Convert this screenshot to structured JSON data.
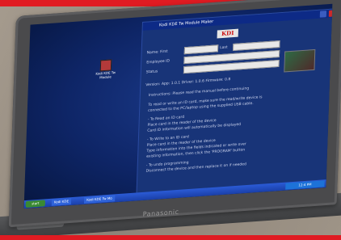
{
  "window": {
    "title": "Kodi KDE Tw Module Maker"
  },
  "logo": "KDI",
  "form": {
    "name_label": "Name: First",
    "last_label": "Last",
    "employee_label": "Employee ID",
    "status_label": "Status",
    "version_line": "Version: App: 1.0.1 Driver: 1.0.6 Firmware: 0.8"
  },
  "instructions": {
    "heading": "Instructions: Please read the manual before continuing",
    "lines": [
      "To read or write an ID card, make sure the read/write device is",
      "connected to the PC/laptop using the supplied USB cable.",
      "- To Read an ID card",
      "  Place card in the reader of the device",
      "  Card ID information will automatically be displayed",
      "- To Write to an ID card",
      "  Place card in the reader of the device",
      "  Type information into the fields indicated or write over",
      "  existing information, then click the 'PROGRAM' button",
      "- To undo programming",
      "  Disconnect the device and then replace it on if needed"
    ]
  },
  "desktop_icon": {
    "label": "Kodi KDE Tw Module"
  },
  "taskbar": {
    "start": "start",
    "task1": "Kodi KDE",
    "task2": "Kodi KDE Tw Mo",
    "tray": "12:4 PM"
  },
  "brand": "Panasonic",
  "colors": {
    "accent": "#e01b22",
    "screen": "#0e2566"
  }
}
